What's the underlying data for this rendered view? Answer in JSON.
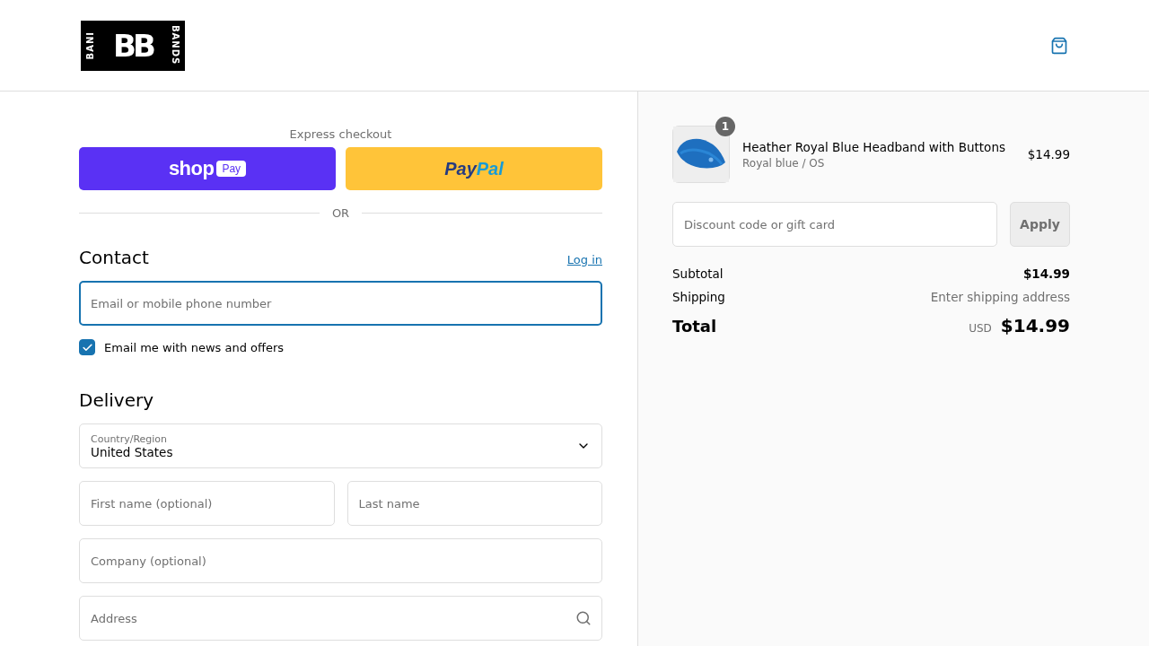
{
  "logo": {
    "left": "BANI",
    "center": "BB",
    "right": "BANDS"
  },
  "express": {
    "title": "Express checkout",
    "shop_pay": {
      "word": "shop",
      "badge": "Pay"
    },
    "paypal": {
      "first": "Pay",
      "second": "Pal"
    },
    "divider": "OR"
  },
  "contact": {
    "title": "Contact",
    "login": "Log in",
    "email": {
      "placeholder": "Email or mobile phone number",
      "focused": true
    },
    "newsletter": {
      "label": "Email me with news and offers",
      "checked": true
    }
  },
  "delivery": {
    "title": "Delivery",
    "country": {
      "label": "Country/Region",
      "value": "United States"
    },
    "fields": [
      {
        "placeholder": "First name (optional)",
        "kind": "half"
      },
      {
        "placeholder": "Last name",
        "kind": "half"
      },
      {
        "placeholder": "Company (optional)",
        "kind": "full"
      },
      {
        "placeholder": "Address",
        "kind": "search"
      }
    ]
  },
  "summary": {
    "items": [
      {
        "quantity": "1",
        "name": "Heather Royal Blue Headband with Buttons",
        "variant": "Royal blue / OS",
        "price": "$14.99"
      }
    ],
    "discount": {
      "placeholder": "Discount code or gift card",
      "button": "Apply"
    },
    "lines": [
      {
        "label": "Subtotal",
        "value": "$14.99",
        "kind": "amount"
      },
      {
        "label": "Shipping",
        "value": "Enter shipping address",
        "kind": "note"
      }
    ],
    "total": {
      "label": "Total",
      "currency": "USD",
      "value": "$14.99"
    }
  }
}
